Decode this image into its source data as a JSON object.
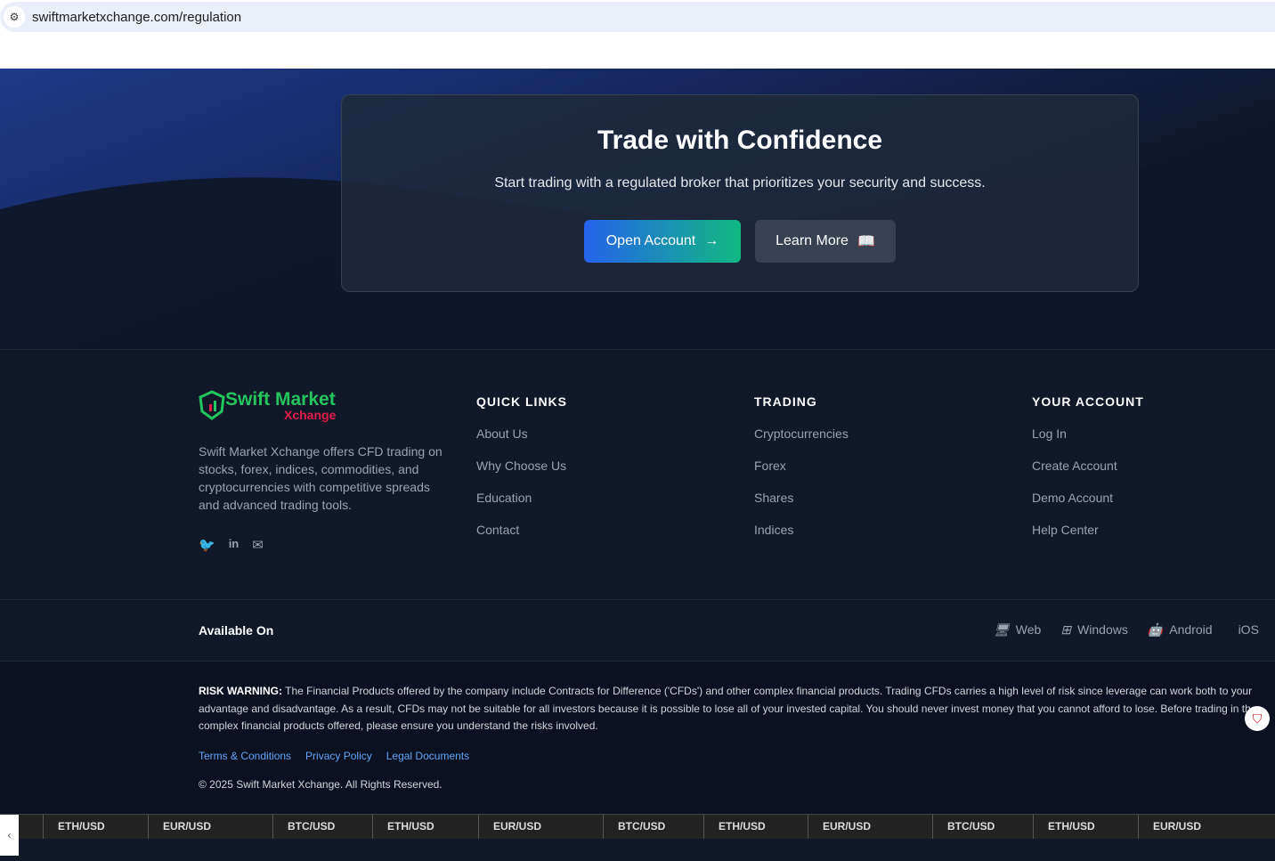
{
  "browser": {
    "url": "swiftmarketxchange.com/regulation",
    "site_icon": "tune-icon"
  },
  "hero": {
    "title": "Trade with Confidence",
    "subtitle": "Start trading with a regulated broker that prioritizes your security and success.",
    "open_account": "Open Account",
    "learn_more": "Learn More"
  },
  "brand": {
    "name_top": "Swift Market",
    "name_bottom": "Xchange",
    "description": "Swift Market Xchange offers CFD trading on stocks, forex, indices, commodities, and cryptocurrencies with competitive spreads and advanced trading tools."
  },
  "columns": [
    {
      "title": "QUICK LINKS",
      "items": [
        "About Us",
        "Why Choose Us",
        "Education",
        "Contact"
      ]
    },
    {
      "title": "TRADING",
      "items": [
        "Cryptocurrencies",
        "Forex",
        "Shares",
        "Indices"
      ]
    },
    {
      "title": "YOUR ACCOUNT",
      "items": [
        "Log In",
        "Create Account",
        "Demo Account",
        "Help Center"
      ]
    }
  ],
  "available": {
    "label": "Available On",
    "platforms": [
      "Web",
      "Windows",
      "Android",
      "iOS"
    ]
  },
  "risk": {
    "label": "RISK WARNING:",
    "text": " The Financial Products offered by the company include Contracts for Difference ('CFDs') and other complex financial products. Trading CFDs carries a high level of risk since leverage can work both to your advantage and disadvantage. As a result, CFDs may not be suitable for all investors because it is possible to lose all of your invested capital. You should never invest money that you cannot afford to lose. Before trading in the complex financial products offered, please ensure you understand the risks involved."
  },
  "legal_links": [
    "Terms & Conditions",
    "Privacy Policy",
    "Legal Documents"
  ],
  "copyright": "© 2025 Swift Market Xchange. All Rights Reserved.",
  "ticker": [
    "ETH/USD",
    "EUR/USD",
    "BTC/USD",
    "ETH/USD",
    "EUR/USD",
    "BTC/USD",
    "ETH/USD",
    "EUR/USD",
    "BTC/USD",
    "ETH/USD",
    "EUR/USD"
  ]
}
